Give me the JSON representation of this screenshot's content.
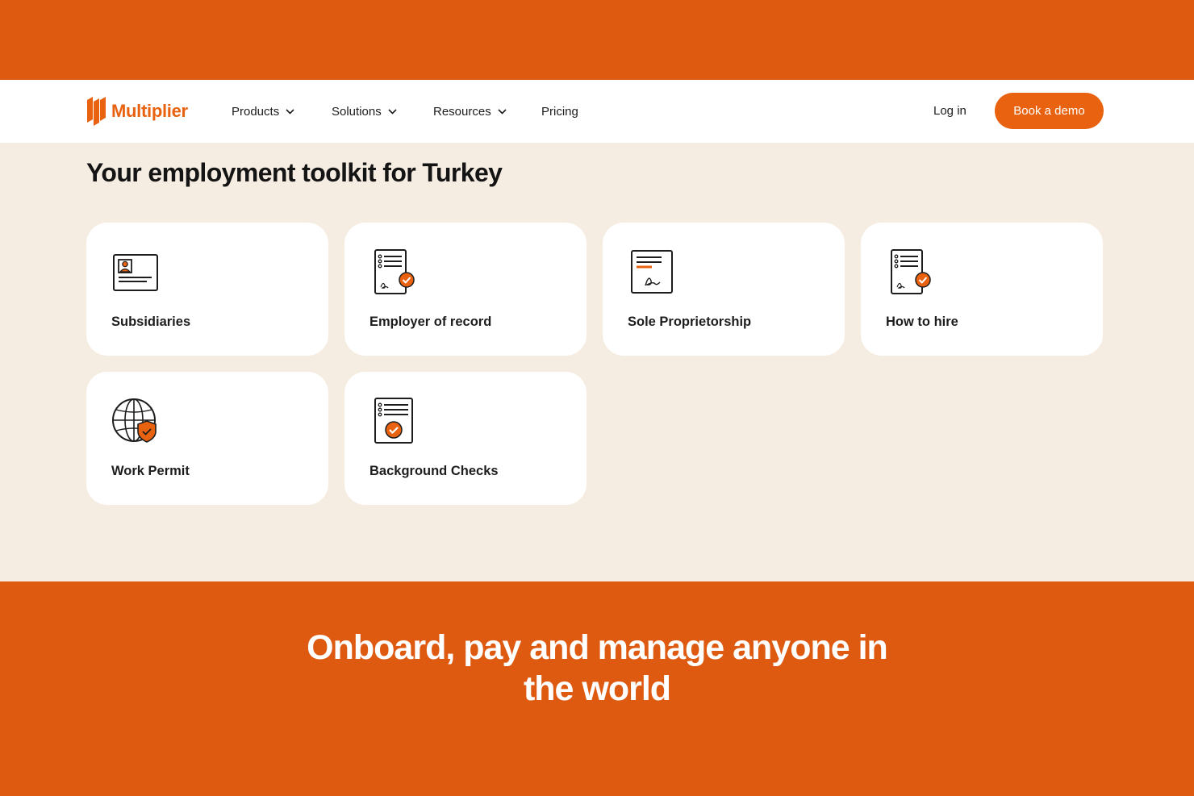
{
  "brand": {
    "name": "Multiplier",
    "accent": "#e8620f",
    "band": "#de5a10",
    "background": "#f6ede2"
  },
  "nav": {
    "items": [
      {
        "label": "Products",
        "has_dropdown": true
      },
      {
        "label": "Solutions",
        "has_dropdown": true
      },
      {
        "label": "Resources",
        "has_dropdown": true
      },
      {
        "label": "Pricing",
        "has_dropdown": false
      }
    ],
    "login_label": "Log in",
    "cta_label": "Book a demo"
  },
  "toolkit": {
    "title": "Your employment toolkit for Turkey",
    "cards": [
      {
        "label": "Subsidiaries",
        "icon": "id-card-icon"
      },
      {
        "label": "Employer of record",
        "icon": "signed-contract-check-icon"
      },
      {
        "label": "Sole Proprietorship",
        "icon": "signed-document-icon"
      },
      {
        "label": "How to hire",
        "icon": "signed-contract-check-icon"
      },
      {
        "label": "Work Permit",
        "icon": "globe-shield-icon"
      },
      {
        "label": "Background Checks",
        "icon": "checklist-document-icon"
      }
    ]
  },
  "footer_cta": {
    "line1": "Onboard, pay and manage anyone in",
    "line2": "the world"
  }
}
